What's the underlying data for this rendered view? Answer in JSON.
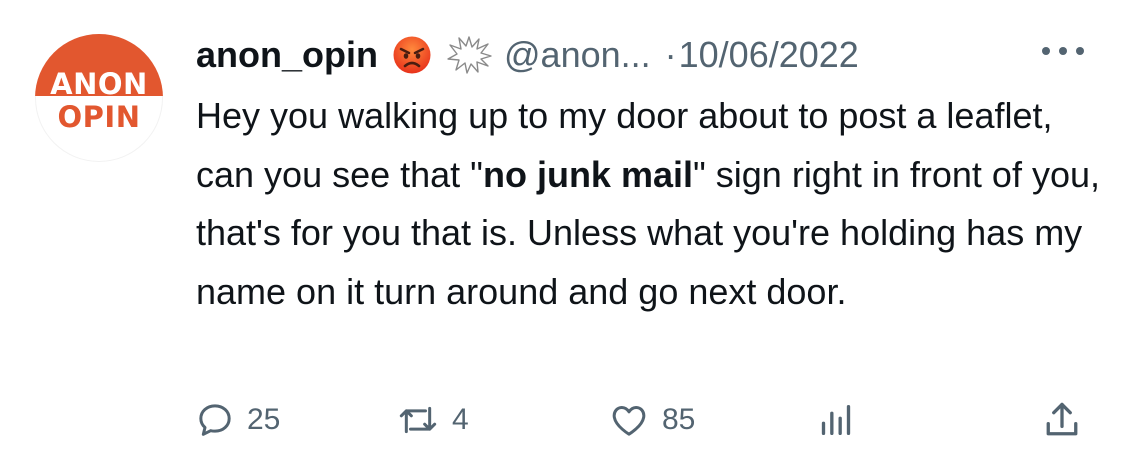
{
  "avatar": {
    "line1": "ANON",
    "line2": "OPIN",
    "icon": "anon-opin-logo-avatar",
    "color": "#e2572f"
  },
  "tweet": {
    "display_name": "anon_opin",
    "badges": [
      "angry-face-emoji-icon",
      "anger-burst-emoji-icon"
    ],
    "handle": "@anon...",
    "separator": "·",
    "date": "10/06/2022",
    "text_before": "Hey you walking up to my door about to post a leaflet, can you see that \"",
    "text_bold": "no junk mail",
    "text_after": "\" sign right in front of you, that's for you that is. Unless what you're holding has my name on it turn around and go next door."
  },
  "actions": {
    "reply": {
      "icon": "reply-bubble-icon",
      "count": "25"
    },
    "retweet": {
      "icon": "retweet-icon",
      "count": "4"
    },
    "like": {
      "icon": "heart-icon",
      "count": "85"
    },
    "views": {
      "icon": "views-bar-chart-icon"
    },
    "share": {
      "icon": "share-upload-icon"
    }
  },
  "colors": {
    "text": "#0f1419",
    "muted": "#536471",
    "brand": "#e2572f"
  }
}
